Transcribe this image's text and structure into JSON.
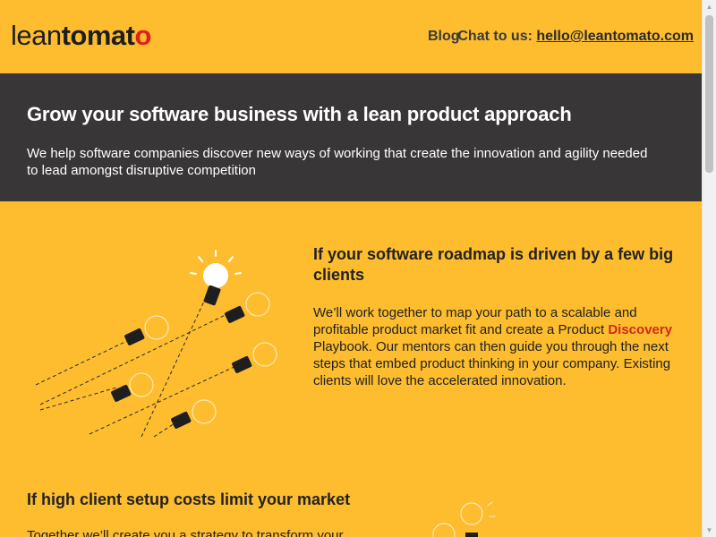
{
  "header": {
    "logo": {
      "part1": "lean",
      "part2": "tomat",
      "part3": "o"
    },
    "nav": {
      "blog": "Blog",
      "chat_label": "Chat to us:",
      "chat_email": "hello@leantomato.com"
    }
  },
  "hero": {
    "title": "Grow your software business with a lean product approach",
    "description": "We help software companies discover new ways of working that create the innovation and agility needed to lead amongst disruptive competition"
  },
  "section1": {
    "title": "If your software roadmap is driven by a few big clients",
    "body_before": "We’ll work together to map your path to a scalable and profitable product market fit and create a Product ",
    "highlight": "Discovery",
    "body_after": " Playbook. Our mentors can then guide you through the next steps that embed product thinking in your company. Existing clients will love the accelerated innovation."
  },
  "section2": {
    "title": "If high client setup costs limit your market",
    "body": "Together we’ll create you a strategy to transform your"
  },
  "colors": {
    "background": "#fdbd2f",
    "hero_background": "#393637",
    "accent_red": "#e0201b",
    "highlight_red": "#d2281a"
  },
  "icons": [
    "lightbulb-illustration",
    "scroll-up-arrow",
    "scroll-down-arrow"
  ]
}
